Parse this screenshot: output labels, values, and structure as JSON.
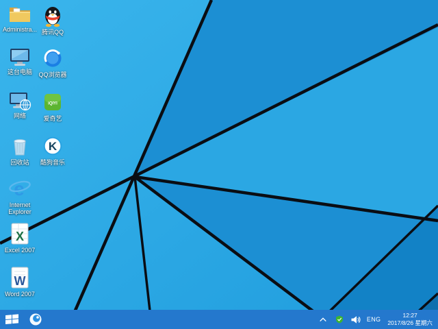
{
  "desktop": {
    "icons": [
      {
        "name": "administrator-folder",
        "label": "Administra..."
      },
      {
        "name": "this-pc",
        "label": "这台电脑"
      },
      {
        "name": "network",
        "label": "网络"
      },
      {
        "name": "recycle-bin",
        "label": "回收站"
      },
      {
        "name": "internet-explorer",
        "label": "Internet Explorer",
        "glyph": "e"
      },
      {
        "name": "excel-2007",
        "label": "Excel 2007",
        "glyph": "X"
      },
      {
        "name": "word-2007",
        "label": "Word 2007",
        "glyph": "W"
      },
      {
        "name": "tencent-qq",
        "label": "腾讯QQ"
      },
      {
        "name": "qq-browser",
        "label": "QQ浏览器"
      },
      {
        "name": "iqiyi",
        "label": "爱奇艺",
        "glyph": "iQIYI"
      },
      {
        "name": "kugou-music",
        "label": "酷狗音乐",
        "glyph": "K"
      }
    ]
  },
  "taskbar": {
    "tray": {
      "language": "ENG",
      "time": "12:27",
      "date": "2017/8/26 星期六"
    }
  },
  "colors": {
    "wallpaper_top": "#3ab5ec",
    "wallpaper_bottom": "#1f9cdd",
    "wedge_dark": "#1c8fd3",
    "wedge_mid": "#2ba7e3",
    "wedge_deep": "#1282c6",
    "corner_deep": "#0f6fae",
    "beam": "#0a0d13",
    "taskbar_bg": "#2478cd",
    "label_text": "#ffffff"
  }
}
